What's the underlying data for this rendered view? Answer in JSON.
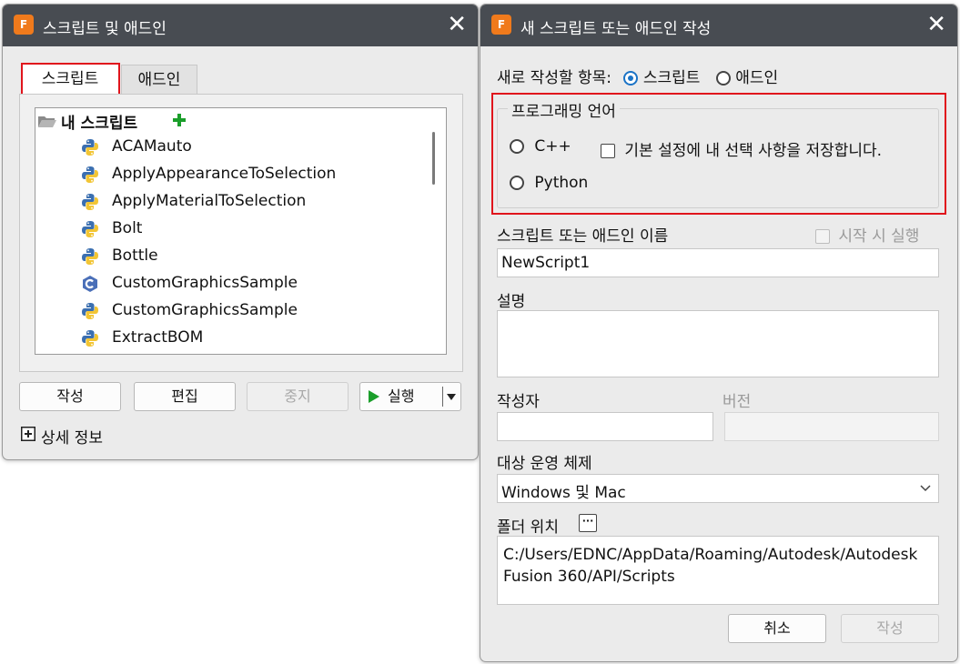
{
  "left_window": {
    "title": "스크립트 및 애드인",
    "icon_text": "F",
    "tabs": [
      {
        "label": "스크립트"
      },
      {
        "label": "애드인"
      }
    ],
    "tree": {
      "root_label": "내 스크립트",
      "items": [
        {
          "label": "ACAMauto",
          "icon": "python-icon"
        },
        {
          "label": "ApplyAppearanceToSelection",
          "icon": "python-icon"
        },
        {
          "label": "ApplyMaterialToSelection",
          "icon": "python-icon"
        },
        {
          "label": "Bolt",
          "icon": "python-icon"
        },
        {
          "label": "Bottle",
          "icon": "python-icon"
        },
        {
          "label": "CustomGraphicsSample",
          "icon": "cpp-icon"
        },
        {
          "label": "CustomGraphicsSample",
          "icon": "python-icon"
        },
        {
          "label": "ExtractBOM",
          "icon": "python-icon"
        }
      ]
    },
    "buttons": {
      "create": "작성",
      "edit": "편집",
      "stop": "중지",
      "run": "실행"
    },
    "details_label": "상세 정보"
  },
  "right_window": {
    "title": "새 스크립트 또는 애드인 작성",
    "icon_text": "F",
    "create_type_label": "새로 작성할 항목:",
    "create_type_options": [
      {
        "label": "스크립트",
        "selected": true
      },
      {
        "label": "애드인",
        "selected": false
      }
    ],
    "language_group_label": "프로그래밍 언어",
    "languages": [
      {
        "label": "C++",
        "selected": false
      },
      {
        "label": "Python",
        "selected": false
      }
    ],
    "save_default_label": "기본 설정에 내 선택 사항을 저장합니다.",
    "name_label": "스크립트 또는 애드인 이름",
    "run_on_startup_label": "시작 시 실행",
    "name_value": "NewScript1",
    "description_label": "설명",
    "description_value": "",
    "author_label": "작성자",
    "author_value": "",
    "version_label": "버전",
    "version_value": "",
    "os_label": "대상 운영 체제",
    "os_value": "Windows 및 Mac",
    "folder_label": "폴더 위치",
    "folder_browse": "···",
    "folder_path": "C:/Users/EDNC/AppData/Roaming/Autodesk/Autodesk Fusion 360/API/Scripts",
    "buttons": {
      "cancel": "취소",
      "create": "작성"
    }
  },
  "colors": {
    "titlebar": "#484c52",
    "highlight_box": "#e0141c",
    "accent": "#1a73c6",
    "run_green": "#1a9e2a"
  }
}
